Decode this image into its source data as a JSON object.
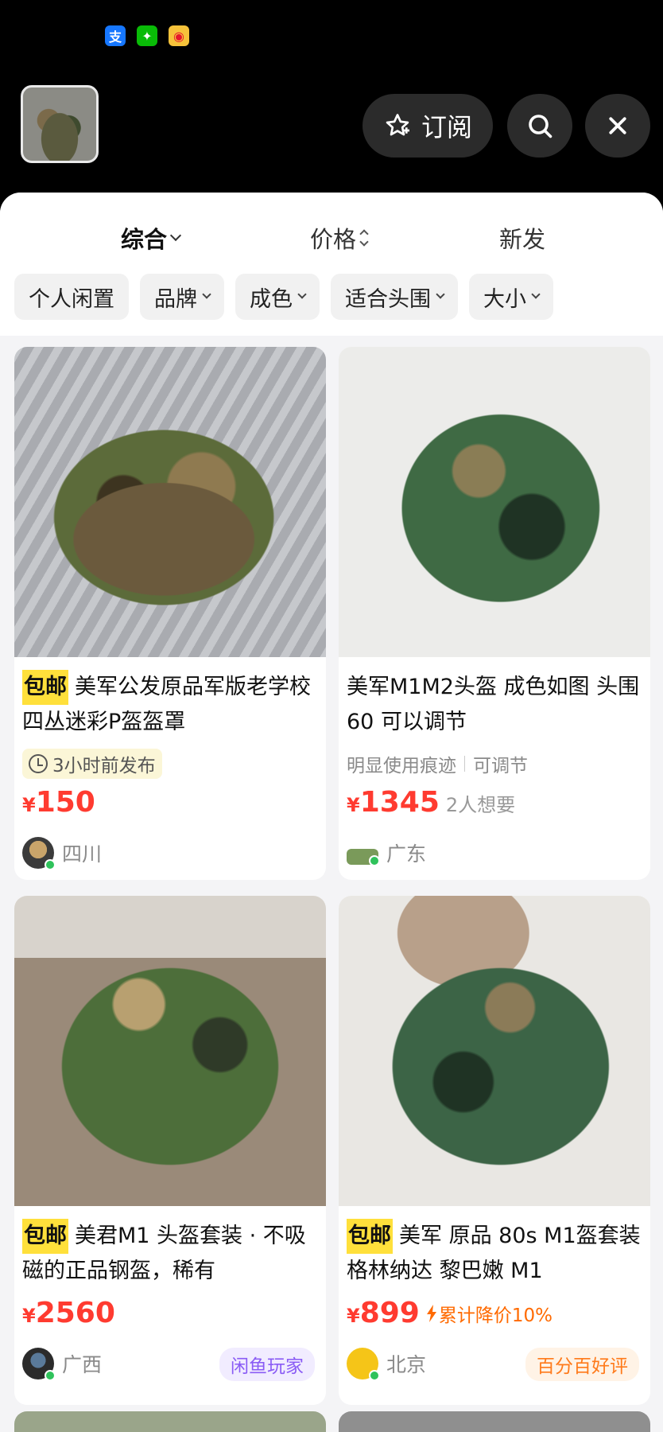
{
  "status_icons": [
    {
      "name": "alipay-icon",
      "glyph": "支"
    },
    {
      "name": "wechat-icon",
      "glyph": "✦"
    },
    {
      "name": "weibo-icon",
      "glyph": "◉"
    }
  ],
  "topbar": {
    "subscribe_label": "订阅"
  },
  "sort": [
    {
      "label": "综合",
      "active": true
    },
    {
      "label": "价格"
    },
    {
      "label": "新发"
    }
  ],
  "filters": [
    {
      "label": "个人闲置"
    },
    {
      "label": "品牌"
    },
    {
      "label": "成色"
    },
    {
      "label": "适合头围"
    },
    {
      "label": "大小"
    }
  ],
  "items": [
    {
      "tag": "包邮",
      "title": "美军公发原品军版老学校四丛迷彩P盔盔罩",
      "time_badge": "3小时前发布",
      "currency": "¥",
      "price": "150",
      "location": "四川"
    },
    {
      "title": "美军M1M2头盔 成色如图 头围60 可以调节",
      "attrs": [
        "明显使用痕迹",
        "可调节"
      ],
      "currency": "¥",
      "price": "1345",
      "want": "2人想要",
      "location": "广东"
    },
    {
      "tag": "包邮",
      "title": "美君M1 头盔套装 · 不吸磁的正品钢盔，稀有",
      "currency": "¥",
      "price": "2560",
      "location": "广西",
      "badge": "闲鱼玩家"
    },
    {
      "tag": "包邮",
      "title": "美军 原品 80s M1盔套装 格林纳达 黎巴嫩 M1",
      "currency": "¥",
      "price": "899",
      "drop": "累计降价10%",
      "location": "北京",
      "badge": "百分百好评"
    }
  ],
  "colors": {
    "price": "#ff3b30",
    "tag_bg": "#ffe03b",
    "online": "#2fc25b"
  }
}
